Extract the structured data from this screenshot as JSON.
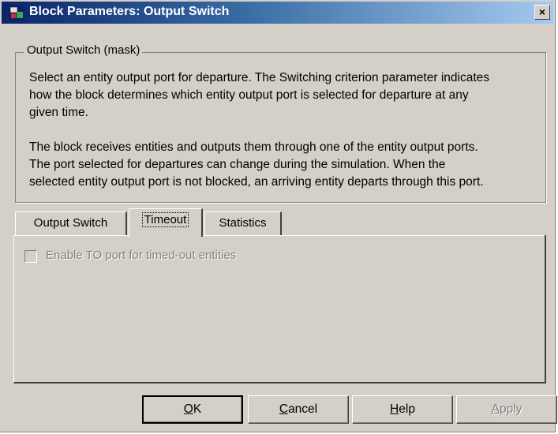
{
  "window": {
    "title": "Block Parameters: Output Switch",
    "close_label": "×"
  },
  "group": {
    "legend": "Output Switch (mask)",
    "paragraph1_lines": [
      "Select an entity output port for departure. The Switching criterion parameter indicates",
      "how the block determines which entity output port is selected for departure at any",
      "given time."
    ],
    "paragraph2_lines": [
      "The block receives entities and outputs them through one of the entity output ports.",
      "The port selected for departures can change during the simulation. When the",
      "selected entity output port is not blocked, an arriving entity departs through this port."
    ]
  },
  "tabs": [
    {
      "label": "Output Switch",
      "active": false
    },
    {
      "label": "Timeout",
      "active": true
    },
    {
      "label": "Statistics",
      "active": false
    }
  ],
  "timeout_panel": {
    "checkbox_label": "Enable TO port for timed-out entities",
    "checked": false,
    "enabled": false
  },
  "buttons": {
    "ok": {
      "mnemonic": "O",
      "rest": "K"
    },
    "cancel": {
      "mnemonic": "C",
      "rest": "ancel"
    },
    "help": {
      "mnemonic": "H",
      "rest": "elp"
    },
    "apply": {
      "mnemonic": "A",
      "rest": "pply",
      "enabled": false
    }
  },
  "icons": {
    "title_icon": "simulink-block-icon",
    "close_icon": "close-icon"
  }
}
